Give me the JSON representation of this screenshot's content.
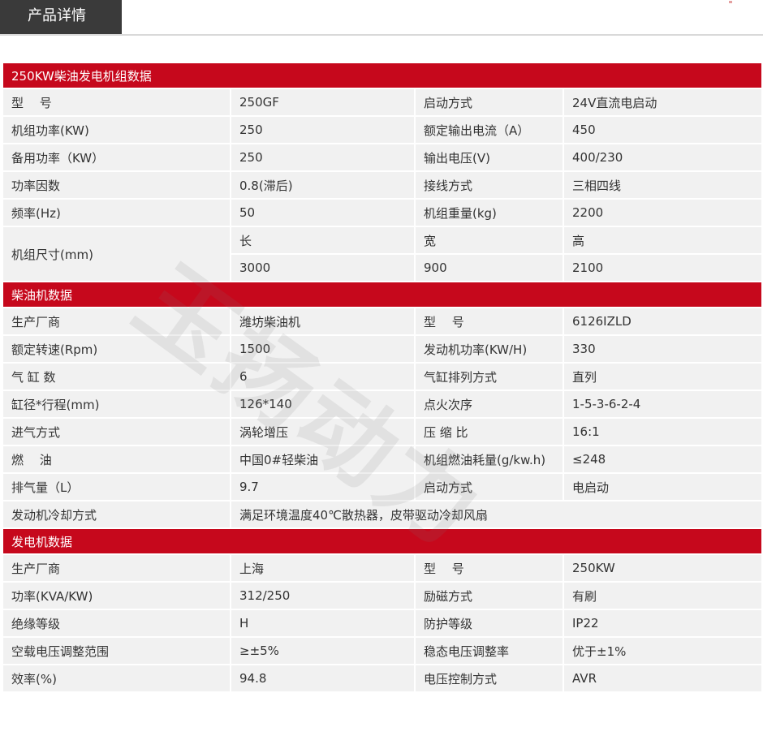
{
  "tab": {
    "label": "产品详情"
  },
  "watermark": "玉扬动力",
  "section1": {
    "title": "250KW柴油发电机组数据",
    "rows": [
      [
        "型　 号",
        "250GF",
        "启动方式",
        "24V直流电启动"
      ],
      [
        "机组功率(KW)",
        "250",
        "额定输出电流（A）",
        "450"
      ],
      [
        "备用功率（KW）",
        "250",
        "输出电压(V)",
        "400/230"
      ],
      [
        "功率因数",
        "0.8(滞后)",
        "接线方式",
        "三相四线"
      ],
      [
        "频率(Hz)",
        "50",
        "机组重量(kg)",
        "2200"
      ]
    ],
    "size": {
      "label": "机组尺寸(mm)",
      "head": [
        "长",
        "宽",
        "高"
      ],
      "vals": [
        "3000",
        "900",
        "2100"
      ]
    }
  },
  "section2": {
    "title": "柴油机数据",
    "rows": [
      [
        "生产厂商",
        "潍坊柴油机",
        "型　 号",
        "6126IZLD"
      ],
      [
        "额定转速(Rpm)",
        "1500",
        "发动机功率(KW/H)",
        "330"
      ],
      [
        "气 缸 数",
        "6",
        "气缸排列方式",
        "直列"
      ],
      [
        "缸径*行程(mm)",
        "126*140",
        "点火次序",
        "1-5-3-6-2-4"
      ],
      [
        "进气方式",
        "涡轮增压",
        "压  缩  比",
        "16:1"
      ],
      [
        "燃　 油",
        "中国0#轻柴油",
        "机组燃油耗量(g/kw.h)",
        "≤248"
      ],
      [
        "排气量（L）",
        "9.7",
        "启动方式",
        "电启动"
      ]
    ],
    "cooling": {
      "label": "发动机冷却方式",
      "value": "满足环境温度40℃散热器，皮带驱动冷却风扇"
    }
  },
  "section3": {
    "title": "发电机数据",
    "rows": [
      [
        "生产厂商",
        "上海",
        "型　 号",
        "250KW"
      ],
      [
        "功率(KVA/KW)",
        "312/250",
        "励磁方式",
        "有刷"
      ],
      [
        "绝缘等级",
        "H",
        "防护等级",
        "IP22"
      ],
      [
        "空载电压调整范围",
        "≥±5%",
        "稳态电压调整率",
        "优于±1%"
      ],
      [
        "效率(%)",
        "94.8",
        "电压控制方式",
        "AVR"
      ]
    ]
  },
  "colors": {
    "section_red": "#c6081c",
    "tab_dark": "#3a3a3a",
    "cell_gray": "#f1f1f1"
  }
}
